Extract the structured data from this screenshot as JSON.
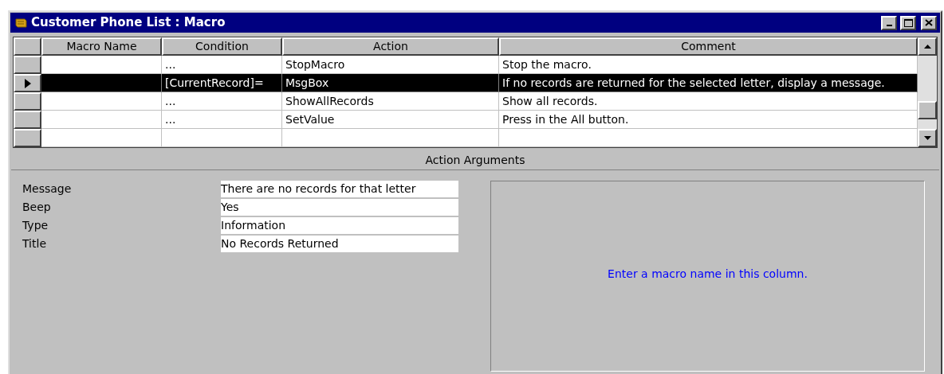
{
  "window": {
    "title": "Customer Phone List : Macro"
  },
  "grid": {
    "columns": [
      "Macro Name",
      "Condition",
      "Action",
      "Comment"
    ],
    "rows": [
      {
        "selected": false,
        "cells": [
          "",
          "...",
          "StopMacro",
          "Stop the macro."
        ]
      },
      {
        "selected": true,
        "cells": [
          "",
          "[CurrentRecord]=",
          "MsgBox",
          "If no records are returned for the selected letter, display a message."
        ]
      },
      {
        "selected": false,
        "cells": [
          "",
          "...",
          "ShowAllRecords",
          "Show all records."
        ]
      },
      {
        "selected": false,
        "cells": [
          "",
          "...",
          "SetValue",
          "Press in the All button."
        ]
      },
      {
        "selected": false,
        "cells": [
          "",
          "",
          "",
          ""
        ]
      }
    ]
  },
  "arguments": {
    "title": "Action Arguments",
    "fields": [
      {
        "label": "Message",
        "value": "There are no records for that letter"
      },
      {
        "label": "Beep",
        "value": "Yes"
      },
      {
        "label": "Type",
        "value": "Information"
      },
      {
        "label": "Title",
        "value": "No Records Returned"
      }
    ],
    "help": "Enter a macro name in this column."
  }
}
